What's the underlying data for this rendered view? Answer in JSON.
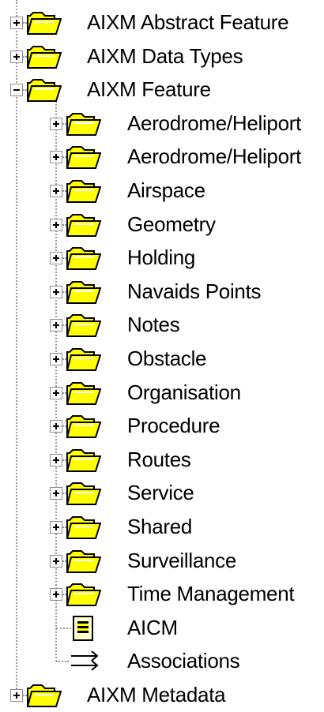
{
  "tree": {
    "top_items": [
      {
        "label": "AIXM Abstract Feature",
        "icon": "folder-icon",
        "expanded": false
      },
      {
        "label": "AIXM Data Types",
        "icon": "folder-icon",
        "expanded": false
      },
      {
        "label": "AIXM Feature",
        "icon": "folder-icon",
        "expanded": true
      },
      {
        "label": "AIXM Metadata",
        "icon": "folder-icon",
        "expanded": false
      }
    ],
    "feature_children": [
      {
        "label": "Aerodrome/Heliport",
        "icon": "folder-icon",
        "expandable": true
      },
      {
        "label": "Aerodrome/Heliport",
        "icon": "folder-icon",
        "expandable": true
      },
      {
        "label": "Airspace",
        "icon": "folder-icon",
        "expandable": true
      },
      {
        "label": "Geometry",
        "icon": "folder-icon",
        "expandable": true
      },
      {
        "label": "Holding",
        "icon": "folder-icon",
        "expandable": true
      },
      {
        "label": "Navaids Points",
        "icon": "folder-icon",
        "expandable": true
      },
      {
        "label": "Notes",
        "icon": "folder-icon",
        "expandable": true
      },
      {
        "label": "Obstacle",
        "icon": "folder-icon",
        "expandable": true
      },
      {
        "label": "Organisation",
        "icon": "folder-icon",
        "expandable": true
      },
      {
        "label": "Procedure",
        "icon": "folder-icon",
        "expandable": true
      },
      {
        "label": "Routes",
        "icon": "folder-icon",
        "expandable": true
      },
      {
        "label": "Service",
        "icon": "folder-icon",
        "expandable": true
      },
      {
        "label": "Shared",
        "icon": "folder-icon",
        "expandable": true
      },
      {
        "label": "Surveillance",
        "icon": "folder-icon",
        "expandable": true
      },
      {
        "label": "Time Management",
        "icon": "folder-icon",
        "expandable": true
      },
      {
        "label": "AICM",
        "icon": "document-icon",
        "expandable": false
      },
      {
        "label": "Associations",
        "icon": "associations-icon",
        "expandable": false
      }
    ]
  },
  "colors": {
    "folder_fill": "#ffff00",
    "folder_outline": "#000000",
    "tree_lines": "#9a9a9a",
    "background": "#ffffff"
  }
}
